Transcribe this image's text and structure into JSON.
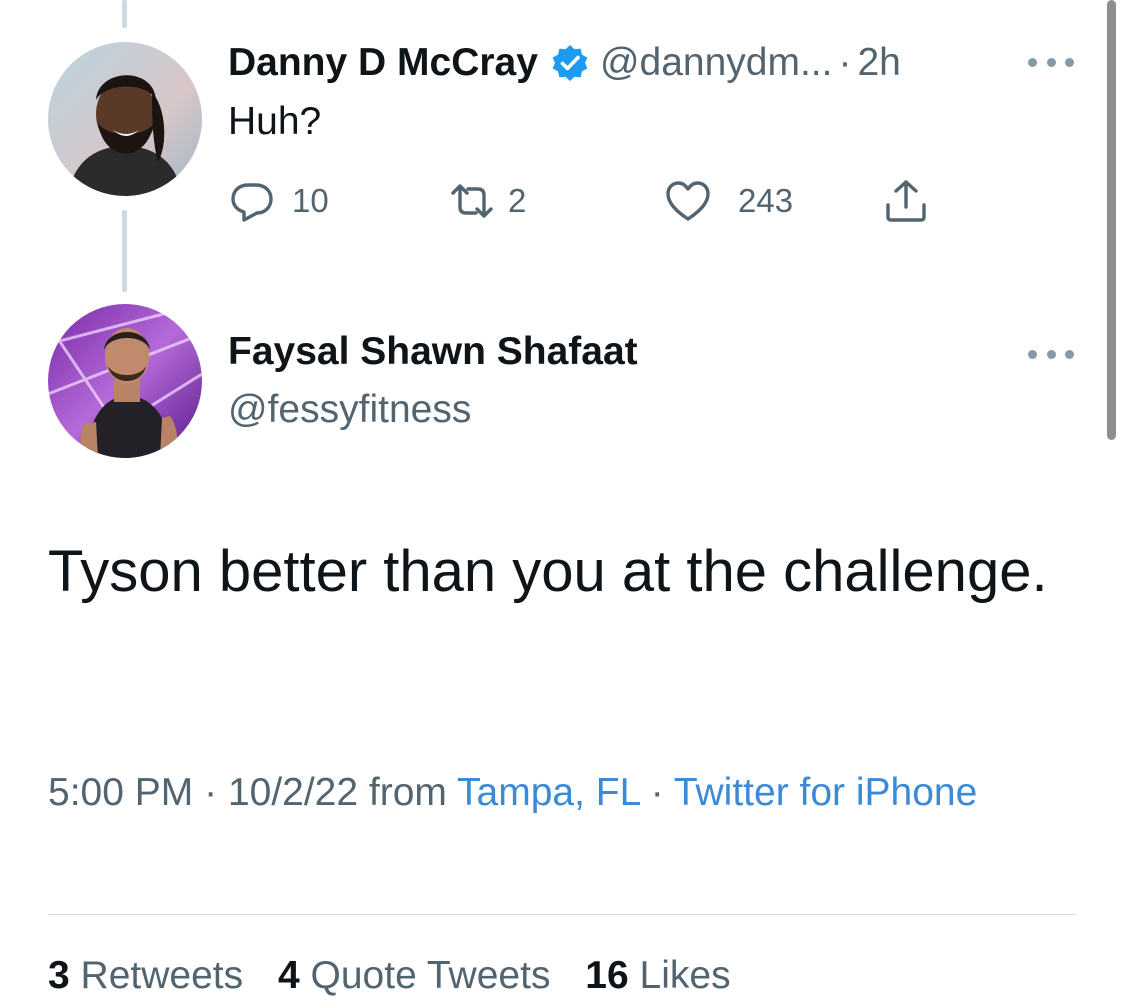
{
  "reply_tweet": {
    "display_name": "Danny D McCray",
    "handle": "@dannydm...",
    "separator": "·",
    "time_ago": "2h",
    "text": "Huh?",
    "actions": {
      "replies": "10",
      "retweets": "2",
      "likes": "243"
    }
  },
  "main_tweet": {
    "display_name": "Faysal Shawn Shafaat",
    "handle": "@fessyfitness",
    "text": "Tyson better than you at the challenge.",
    "time": "5:00 PM",
    "separator": "·",
    "date": "10/2/22",
    "from_label": "from",
    "location": "Tampa, FL",
    "client": "Twitter for iPhone"
  },
  "stats": {
    "retweets_count": "3",
    "retweets_label": "Retweets",
    "quotes_count": "4",
    "quotes_label": "Quote Tweets",
    "likes_count": "16",
    "likes_label": "Likes"
  },
  "colors": {
    "link": "#3b8ad8",
    "verified": "#1d9bf0",
    "secondary_text": "#536471",
    "primary_text": "#0f1419"
  },
  "icons": [
    "verified-badge-icon",
    "more-icon",
    "reply-icon",
    "retweet-icon",
    "like-icon",
    "share-icon"
  ]
}
